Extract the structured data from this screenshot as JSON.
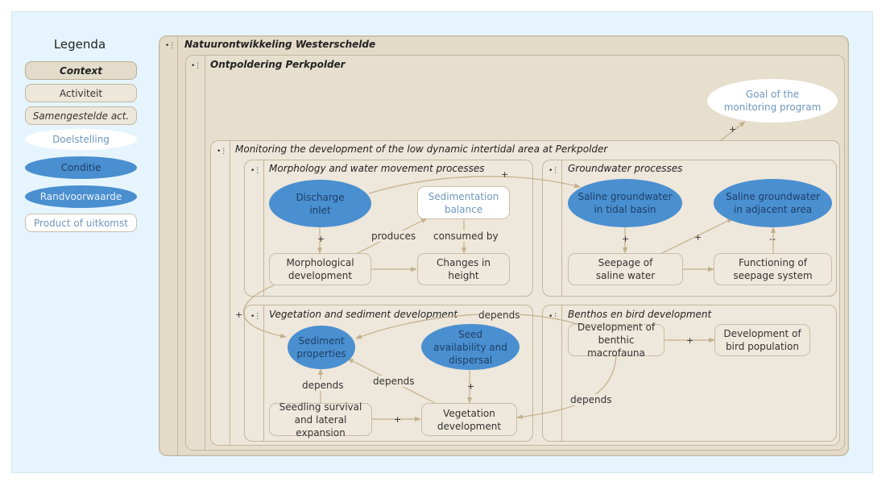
{
  "legend": {
    "title": "Legenda",
    "items": [
      {
        "label": "Context",
        "kind": "context"
      },
      {
        "label": "Activiteit",
        "kind": "activity"
      },
      {
        "label": "Samengestelde act.",
        "kind": "composite-activity"
      },
      {
        "label": "Doelstelling",
        "kind": "goal"
      },
      {
        "label": "Conditie",
        "kind": "condition"
      },
      {
        "label": "Randvoorwaarde",
        "kind": "boundary-condition"
      },
      {
        "label": "Product of uitkomst",
        "kind": "product"
      }
    ]
  },
  "colors": {
    "background": "#e6f5fd",
    "context_fill": "#e4dccb",
    "activity_fill": "#efe8dc",
    "condition_fill": "#4a8fd0",
    "goal_text": "#6f97bd",
    "edge": "#c2b08e"
  },
  "menu_icon": "•⋮",
  "contexts": {
    "outer": "Natuurontwikkeling Westerschelde",
    "inner": "Ontpoldering Perkpolder",
    "monitoring": "Monitoring the development of the low dynamic intertidal area at Perkpolder",
    "morphology": "Morphology and water movement processes",
    "groundwater": "Groundwater processes",
    "vegetation": "Vegetation and sediment development",
    "benthos": "Benthos en bird development"
  },
  "nodes": {
    "goal": "Goal of the monitoring program",
    "discharge_inlet": "Discharge inlet",
    "sedimentation_balance": "Sedimentation balance",
    "morphological_development": "Morphological development",
    "changes_in_height": "Changes in height",
    "saline_tidal": "Saline groundwater in tidal basin",
    "saline_adjacent": "Saline groundwater in adjacent area",
    "seepage": "Seepage of saline water",
    "seepage_system": "Functioning of seepage system",
    "sediment_properties": "Sediment properties",
    "seed_availability": "Seed availability and dispersal",
    "seedling_survival": "Seedling survival and lateral expansion",
    "vegetation_development": "Vegetation development",
    "benthic": "Development of benthic macrofauna",
    "bird": "Development of bird population"
  },
  "edge_labels": {
    "plus": "+",
    "minus": "--",
    "produces": "produces",
    "consumed_by": "consumed by",
    "depends": "depends"
  }
}
